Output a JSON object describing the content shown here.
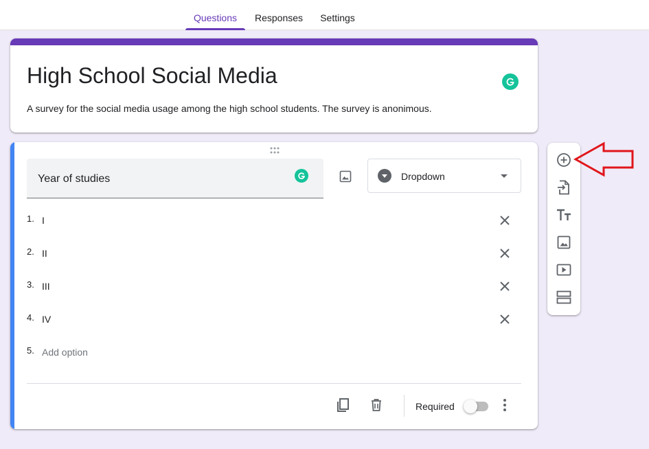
{
  "tabs": [
    {
      "label": "Questions",
      "active": true
    },
    {
      "label": "Responses",
      "active": false
    },
    {
      "label": "Settings",
      "active": false
    }
  ],
  "form": {
    "title": "High School Social Media",
    "description": "A survey for the social media usage among the high school students. The survey is anonimous."
  },
  "question": {
    "title": "Year of studies",
    "type": "Dropdown",
    "options": [
      {
        "number": "1.",
        "label": "I"
      },
      {
        "number": "2.",
        "label": "II"
      },
      {
        "number": "3.",
        "label": "III"
      },
      {
        "number": "4.",
        "label": "IV"
      }
    ],
    "add_option": {
      "number": "5.",
      "label": "Add option"
    },
    "required_label": "Required",
    "required": false
  },
  "side_toolbar": {
    "icons": [
      "add-question-icon",
      "import-questions-icon",
      "add-title-description-icon",
      "add-image-icon",
      "add-video-icon",
      "add-section-icon"
    ]
  },
  "colors": {
    "accent": "#673ab7",
    "active_question": "#4285f4",
    "background": "#f0ebf8",
    "grammarly": "#15c39a",
    "annotation_arrow": "#e0161b"
  }
}
